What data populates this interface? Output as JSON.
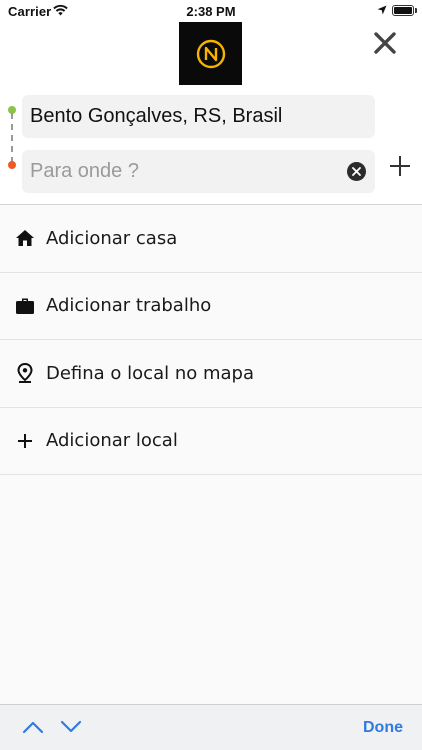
{
  "status_bar": {
    "carrier": "Carrier",
    "time": "2:38 PM",
    "icons": [
      "wifi-icon",
      "location-arrow-icon",
      "battery-icon"
    ]
  },
  "header": {
    "logo_letter": "N",
    "logo_colors": {
      "background": "#0a0a0a",
      "ring": "#f5b400"
    },
    "close_icon": "close-icon"
  },
  "route": {
    "origin_value": "Bento Gonçalves, RS, Brasil",
    "destination_value": "",
    "destination_placeholder": "Para onde ?",
    "origin_dot_color": "#8bc34a",
    "destination_dot_color": "#ef5a22",
    "clear_icon": "clear-icon",
    "add_stop_icon": "plus-icon"
  },
  "list": {
    "items": [
      {
        "icon": "home-icon",
        "label": "Adicionar casa"
      },
      {
        "icon": "briefcase-icon",
        "label": "Adicionar trabalho"
      },
      {
        "icon": "map-pin-icon",
        "label": "Defina o local no mapa"
      },
      {
        "icon": "plus-icon",
        "label": "Adicionar local"
      }
    ]
  },
  "keyboard_accessory": {
    "up_icon": "chevron-up-icon",
    "down_icon": "chevron-down-icon",
    "done_label": "Done",
    "accent_color": "#2f7ae5"
  }
}
